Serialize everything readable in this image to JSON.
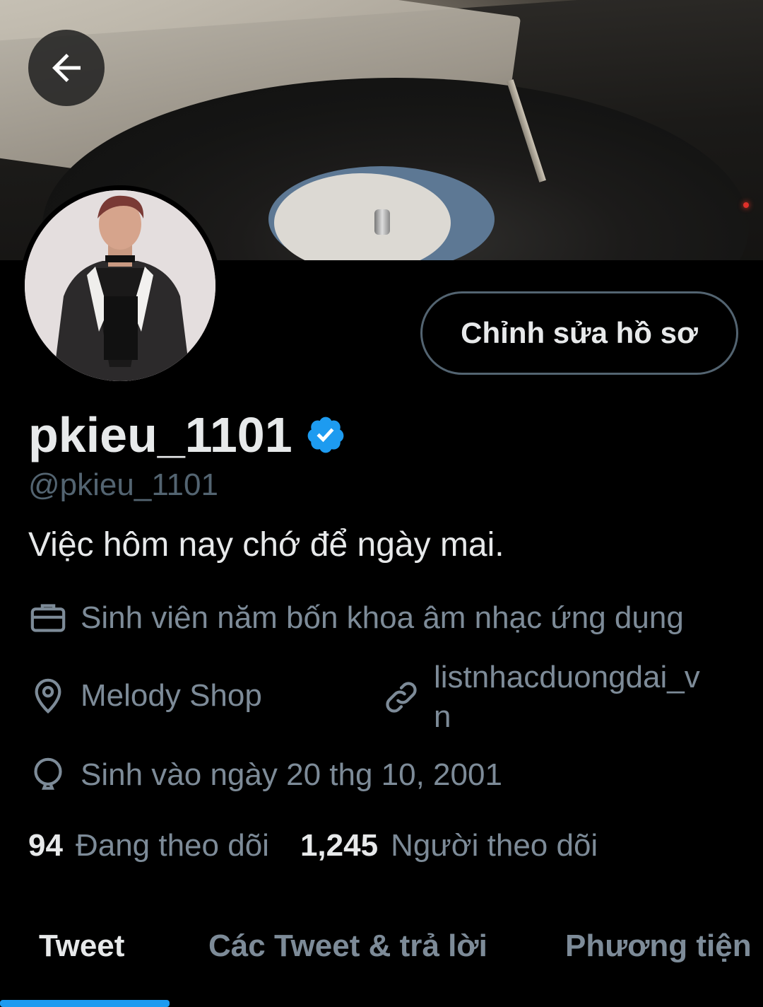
{
  "header": {
    "back_label": "Back"
  },
  "profile": {
    "edit_button_label": "Chỉnh sửa hồ sơ",
    "display_name": "pkieu_1101",
    "handle": "@pkieu_1101",
    "verified": true,
    "bio": "Việc hôm nay chớ để ngày mai.",
    "occupation": "Sinh viên năm bốn khoa âm nhạc ứng dụng",
    "location": "Melody Shop",
    "website_line1": "listnhacduongdai_v",
    "website_line2": "n",
    "birthday": "Sinh vào ngày 20 thg 10, 2001"
  },
  "stats": {
    "following_count": "94",
    "following_label": "Đang theo dõi",
    "followers_count": "1,245",
    "followers_label": "Người theo dõi"
  },
  "tabs": [
    {
      "label": "Tweet",
      "active": true
    },
    {
      "label": "Các Tweet & trả lời",
      "active": false
    },
    {
      "label": "Phương tiện",
      "active": false
    }
  ],
  "icons": {
    "back": "arrow-left-icon",
    "verified": "verified-badge-icon",
    "occupation": "briefcase-icon",
    "location": "location-pin-icon",
    "website": "link-icon",
    "birthday": "balloon-icon"
  },
  "colors": {
    "accent": "#1d9bf0",
    "muted_text": "#7d8b98",
    "border": "#536471",
    "background": "#000000"
  }
}
